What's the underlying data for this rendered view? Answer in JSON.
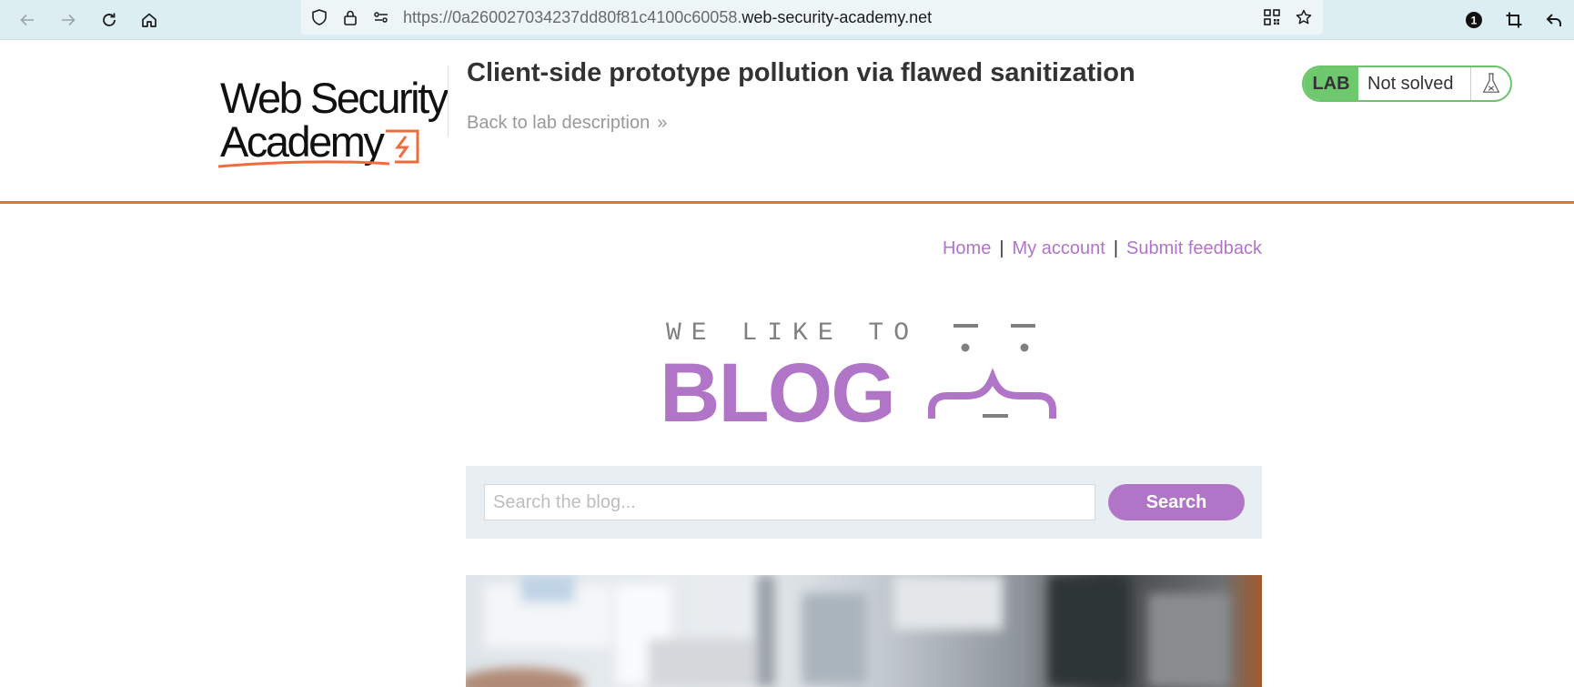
{
  "browser": {
    "url_prefix": "https://0a260027034237dd80f81c4100c60058.",
    "url_host": "web-security-academy.net",
    "extension_badge": "1",
    "icons": [
      "back-arrow-icon",
      "forward-arrow-icon",
      "reload-icon",
      "home-icon",
      "shield-icon",
      "lock-icon",
      "permissions-icon",
      "qr-code-icon",
      "star-icon",
      "extension-icon",
      "crop-icon",
      "undo-icon"
    ]
  },
  "lab": {
    "logo_line1": "Web Security",
    "logo_line2": "Academy",
    "title": "Client-side prototype pollution via flawed sanitization",
    "back_link": "Back to lab description",
    "back_link_chevron": "»",
    "badge": "LAB",
    "status": "Not solved",
    "accent_color": "#ec6e3e",
    "status_color": "#6ec96e"
  },
  "nav": {
    "home": "Home",
    "separator": "|",
    "my_account": "My account",
    "submit_feedback": "Submit feedback",
    "link_color": "#b075c6"
  },
  "blog": {
    "tagline": "WE LIKE TO",
    "word": "BLOG",
    "brand_color": "#b075c6"
  },
  "search": {
    "placeholder": "Search the blog...",
    "value": "",
    "button_label": "Search"
  }
}
